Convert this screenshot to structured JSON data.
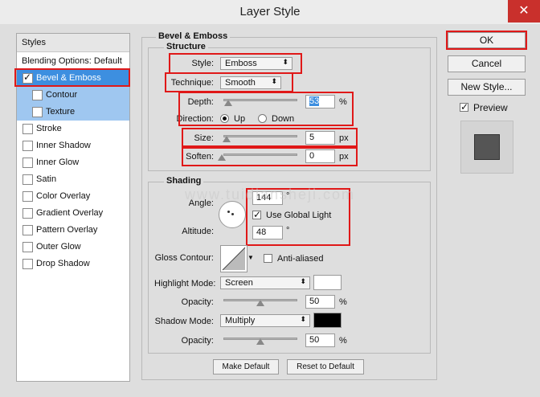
{
  "window": {
    "title": "Layer Style",
    "close": "✕"
  },
  "styles": {
    "header": "Styles",
    "blending": "Blending Options: Default",
    "items": [
      {
        "label": "Bevel & Emboss",
        "checked": true
      },
      {
        "label": "Contour",
        "checked": false
      },
      {
        "label": "Texture",
        "checked": false
      },
      {
        "label": "Stroke",
        "checked": false
      },
      {
        "label": "Inner Shadow",
        "checked": false
      },
      {
        "label": "Inner Glow",
        "checked": false
      },
      {
        "label": "Satin",
        "checked": false
      },
      {
        "label": "Color Overlay",
        "checked": false
      },
      {
        "label": "Gradient Overlay",
        "checked": false
      },
      {
        "label": "Pattern Overlay",
        "checked": false
      },
      {
        "label": "Outer Glow",
        "checked": false
      },
      {
        "label": "Drop Shadow",
        "checked": false
      }
    ]
  },
  "bevel": {
    "title": "Bevel & Emboss",
    "structure_title": "Structure",
    "style_label": "Style:",
    "style_value": "Emboss",
    "technique_label": "Technique:",
    "technique_value": "Smooth",
    "depth_label": "Depth:",
    "depth_value": "53",
    "depth_unit": "%",
    "direction_label": "Direction:",
    "dir_up": "Up",
    "dir_down": "Down",
    "size_label": "Size:",
    "size_value": "5",
    "size_unit": "px",
    "soften_label": "Soften:",
    "soften_value": "0",
    "soften_unit": "px"
  },
  "shading": {
    "title": "Shading",
    "angle_label": "Angle:",
    "angle_value": "144",
    "degree": "°",
    "global_light_label": "Use Global Light",
    "global_light_checked": true,
    "altitude_label": "Altitude:",
    "altitude_value": "48",
    "gloss_label": "Gloss Contour:",
    "antialiased_label": "Anti-aliased",
    "highlight_label": "Highlight Mode:",
    "highlight_value": "Screen",
    "highlight_color": "#ffffff",
    "opacity_label": "Opacity:",
    "highlight_opacity": "50",
    "percent": "%",
    "shadow_label": "Shadow Mode:",
    "shadow_value": "Multiply",
    "shadow_color": "#000000",
    "shadow_opacity": "50"
  },
  "buttons": {
    "make_default": "Make Default",
    "reset_default": "Reset to Default",
    "ok": "OK",
    "cancel": "Cancel",
    "new_style": "New Style...",
    "preview": "Preview"
  },
  "watermark": "www.tuidiansheji.com"
}
